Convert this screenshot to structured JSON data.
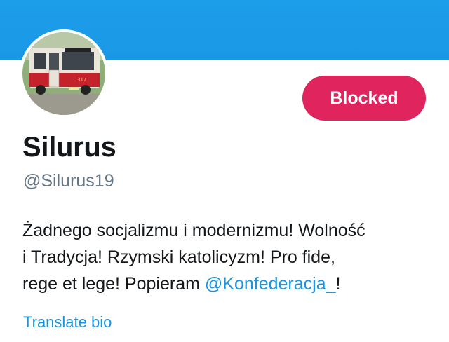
{
  "profile": {
    "display_name": "Silurus",
    "handle": "@Silurus19",
    "blocked_label": "Blocked",
    "bio": {
      "line1": "Żadnego socjalizmu i modernizmu! Wolność",
      "line2": "i Tradycja! Rzymski katolicyzm! Pro fide,",
      "line3_prefix": "rege et lege! Popieram ",
      "mention": "@Konfederacja_",
      "line3_suffix": "!"
    },
    "translate_label": "Translate bio",
    "avatar_number": "317"
  },
  "colors": {
    "banner": "#1d9ee9",
    "blocked_button": "#e0245e",
    "link": "#1b95e0",
    "secondary_text": "#657786",
    "primary_text": "#14171a"
  }
}
